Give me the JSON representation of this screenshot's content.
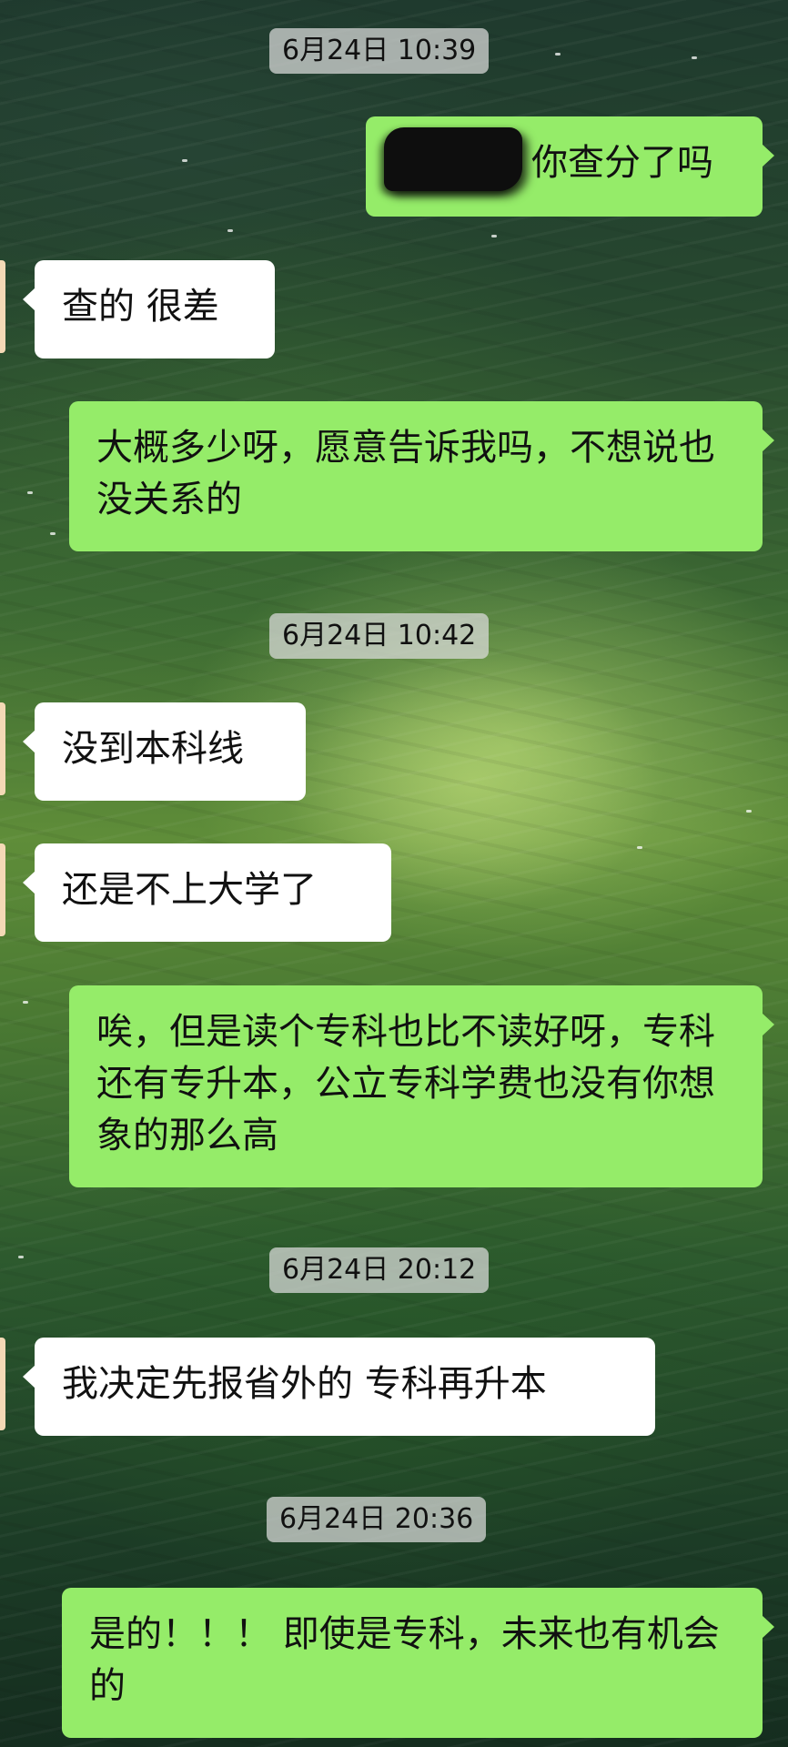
{
  "messages": [
    {
      "type": "timestamp",
      "text": "6月24日 10:39"
    },
    {
      "type": "sent",
      "text": "你查分了吗",
      "redacted_prefix": true
    },
    {
      "type": "received",
      "text": "查的 很差"
    },
    {
      "type": "sent",
      "text": "大概多少呀，愿意告诉我吗，不想说也没关系的"
    },
    {
      "type": "timestamp",
      "text": "6月24日 10:42"
    },
    {
      "type": "received",
      "text": "没到本科线"
    },
    {
      "type": "received",
      "text": "还是不上大学了"
    },
    {
      "type": "sent",
      "text": "唉，但是读个专科也比不读好呀，专科还有专升本，公立专科学费也没有你想象的那么高"
    },
    {
      "type": "timestamp",
      "text": "6月24日 20:12"
    },
    {
      "type": "received",
      "text": "我决定先报省外的 专科再升本"
    },
    {
      "type": "timestamp",
      "text": "6月24日 20:36"
    },
    {
      "type": "sent",
      "text": "是的！！！ 即使是专科，未来也有机会的"
    }
  ],
  "colors": {
    "sent_bubble": "#95ec69",
    "received_bubble": "#ffffff",
    "timestamp_bg": "#dcdcdc"
  }
}
